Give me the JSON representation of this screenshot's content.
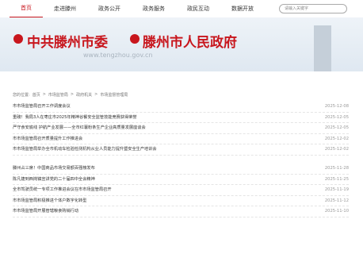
{
  "nav": [
    "首页",
    "走进滕州",
    "政务公开",
    "政务服务",
    "政民互动",
    "数据开放"
  ],
  "search_placeholder": "请输入关键字",
  "banner": {
    "party": "中共滕州市委",
    "gov": "滕州市人民政府",
    "url": "www.tengzhou.gov.cn"
  },
  "breadcrumb": [
    "您的位置:",
    "首页",
    ">",
    "市场监管局",
    ">",
    "政府机关",
    ">",
    "市场监督管理局"
  ],
  "group1": [
    [
      "市市场监管局召开工作调度会议",
      "2025-12-08"
    ],
    [
      "重磅！我局3人在枣庄市2025年精神谷餐安全监管技能竞赛获得荣誉",
      "2025-12-05"
    ],
    [
      "严守食安底线 护航产业发展——全市红薯粉条生产企业高质量发展座谈会",
      "2025-12-05"
    ],
    [
      "市市场监管局召开质量提升工作推进会",
      "2025-12-02"
    ],
    [
      "市市场监管局举办全市机动车检验检测机构从业人员能力提升暨安全生产培训会",
      "2025-12-02"
    ]
  ],
  "group2": [
    [
      "滕州占三席！中国商品市场交易额百强榜发布",
      "2025-11-28"
    ],
    [
      "陈凡捷到西岗镇宣讲党的二十届四中全会精神",
      "2025-11-25"
    ],
    [
      "全市驾驶员统一专项工作推进会议在市市场监管局召开",
      "2025-11-19"
    ],
    [
      "市市场监管局积极推进个体户数字化转型",
      "2025-11-12"
    ],
    [
      "市市场监管局开展管辖粮食购销行动",
      "2025-11-10"
    ]
  ]
}
